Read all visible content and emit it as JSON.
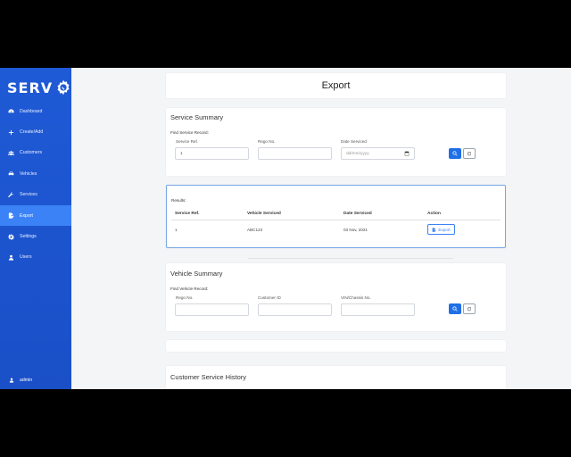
{
  "app": {
    "logo_text": "SERV"
  },
  "sidebar": {
    "items": [
      {
        "label": "Dashboard",
        "icon": "dashboard-icon"
      },
      {
        "label": "Create/Add",
        "icon": "plus-icon"
      },
      {
        "label": "Customers",
        "icon": "users-icon"
      },
      {
        "label": "Vehicles",
        "icon": "car-icon"
      },
      {
        "label": "Services",
        "icon": "wrench-icon"
      },
      {
        "label": "Export",
        "icon": "file-export-icon",
        "active": true
      },
      {
        "label": "Settings",
        "icon": "gear-icon"
      },
      {
        "label": "Users",
        "icon": "user-icon"
      }
    ],
    "user": "admin"
  },
  "page": {
    "title": "Export"
  },
  "service_summary": {
    "title": "Service Summary",
    "find_label": "Find Service Record:",
    "fields": [
      {
        "label": "Service Ref.",
        "value": "1"
      },
      {
        "label": "Rego No.",
        "value": ""
      },
      {
        "label": "Date Serviced",
        "value": "dd/mm/yyyy"
      }
    ]
  },
  "results": {
    "label": "Results:",
    "columns": [
      "Service Ref.",
      "Vehicle Serviced",
      "Date Serviced",
      "Action"
    ],
    "rows": [
      {
        "ref": "1",
        "vehicle": "ABC123",
        "date": "03 Nov, 2021",
        "action": "Export"
      }
    ]
  },
  "vehicle_summary": {
    "title": "Vehicle Summary",
    "find_label": "Find Vehicle Record:",
    "fields": [
      {
        "label": "Rego No.",
        "value": ""
      },
      {
        "label": "Customer ID",
        "value": ""
      },
      {
        "label": "VIN/Chassis No.",
        "value": ""
      }
    ]
  },
  "customer_history": {
    "title": "Customer Service History"
  },
  "colors": {
    "sidebar": "#1f5ad6",
    "active": "#3b82f6",
    "primary_button": "#1f6fe6"
  }
}
